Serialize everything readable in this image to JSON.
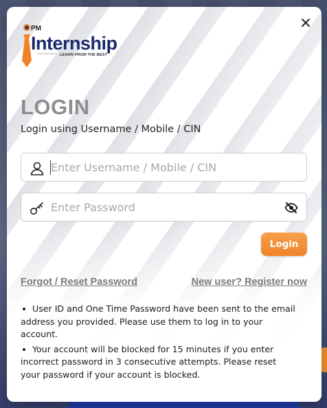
{
  "logo": {
    "prefix": "PM",
    "name": "Internship",
    "tagline": "LEARN FROM THE BEST"
  },
  "dialog": {
    "title": "LOGIN",
    "subtitle": "Login using Username / Mobile / CIN",
    "close_icon": "close-icon"
  },
  "form": {
    "username": {
      "placeholder": "Enter Username / Mobile / CIN",
      "value": "",
      "icon": "user-icon"
    },
    "password": {
      "placeholder": "Enter Password",
      "value": "",
      "icon": "key-icon",
      "toggle_icon": "eye-off-icon"
    },
    "submit_label": "Login"
  },
  "links": {
    "forgot": "Forgot / Reset Password",
    "register": "New user? Register now"
  },
  "notes": [
    "User ID and One Time Password have been sent to the email address you provided. Please use them to log in to your account.",
    "Your account will be blocked for 15 minutes if you enter incorrect password in 3 consecutive attempts. Please reset your password if your account is blocked."
  ],
  "colors": {
    "accent": "#f0832a",
    "heading": "#8e8e8e",
    "link": "#7b7b7b"
  }
}
